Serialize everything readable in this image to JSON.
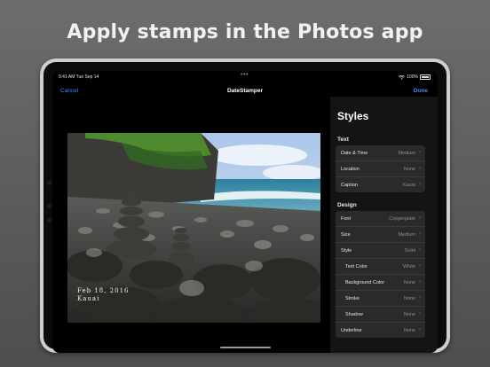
{
  "headline": "Apply stamps in the Photos app",
  "status_bar": {
    "time": "9:41 AM  Tue Sep 14",
    "battery": "100%"
  },
  "nav": {
    "cancel": "Cancel",
    "title": "DateStamper",
    "done": "Done"
  },
  "photo": {
    "caption_date": "Feb 18, 2016",
    "caption_place": "Kauai"
  },
  "styles": {
    "title": "Styles",
    "sections": [
      {
        "header": "Text",
        "rows": [
          {
            "label": "Date & Time",
            "value": "Medium"
          },
          {
            "label": "Location",
            "value": "None"
          },
          {
            "label": "Caption",
            "value": "Kauai"
          }
        ]
      },
      {
        "header": "Design",
        "rows": [
          {
            "label": "Font",
            "value": "Copperplate"
          },
          {
            "label": "Size",
            "value": "Medium"
          },
          {
            "label": "Style",
            "value": "Solid"
          },
          {
            "label": "Text Color",
            "value": "White"
          },
          {
            "label": "Background Color",
            "value": "None"
          },
          {
            "label": "Stroke",
            "value": "None"
          },
          {
            "label": "Shadow",
            "value": "None"
          },
          {
            "label": "Underline",
            "value": "None"
          }
        ]
      }
    ]
  },
  "colors": {
    "accent": "#3a8cff",
    "sidebar_bg": "#141414",
    "group_bg": "#2a2a2a"
  },
  "icons": [
    "wifi-icon",
    "battery-icon",
    "chevron-right-icon",
    "more-dots-icon"
  ]
}
